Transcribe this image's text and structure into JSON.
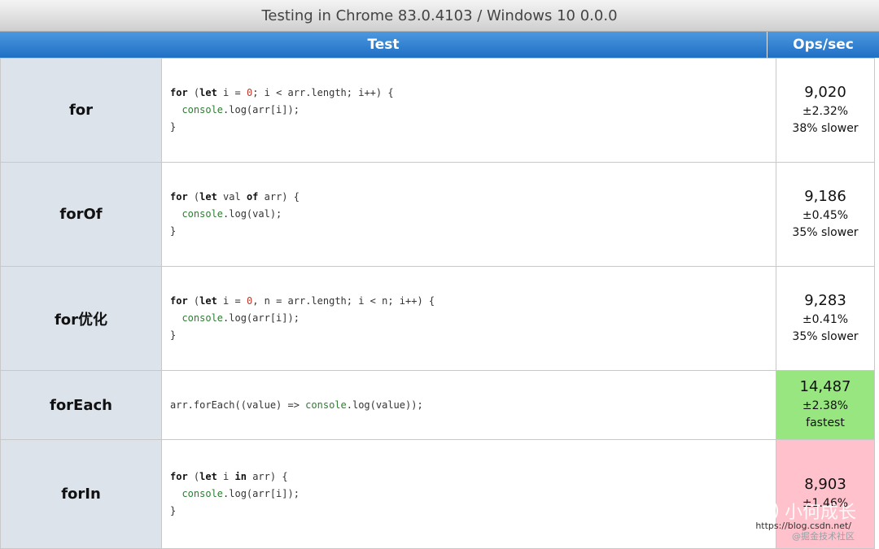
{
  "title_bar": "Testing in Chrome 83.0.4103 / Windows 10 0.0.0",
  "columns": {
    "test": "Test",
    "ops": "Ops/sec"
  },
  "rows": [
    {
      "name": "for",
      "code_lines": [
        [
          [
            "kw",
            "for"
          ],
          [
            "t",
            " ("
          ],
          [
            "kw",
            "let"
          ],
          [
            "t",
            " i = "
          ],
          [
            "num",
            "0"
          ],
          [
            "t",
            "; i < arr.length; i++) {"
          ]
        ],
        [
          [
            "t",
            "  "
          ],
          [
            "fn",
            "console"
          ],
          [
            "t",
            ".log(arr[i]);"
          ]
        ],
        [
          [
            "t",
            "}"
          ]
        ]
      ],
      "ops": "9,020",
      "error": "±2.32%",
      "status": "38% slower",
      "highlight": ""
    },
    {
      "name": "forOf",
      "code_lines": [
        [
          [
            "kw",
            "for"
          ],
          [
            "t",
            " ("
          ],
          [
            "kw",
            "let"
          ],
          [
            "t",
            " val "
          ],
          [
            "kw",
            "of"
          ],
          [
            "t",
            " arr) {"
          ]
        ],
        [
          [
            "t",
            "  "
          ],
          [
            "fn",
            "console"
          ],
          [
            "t",
            ".log(val);"
          ]
        ],
        [
          [
            "t",
            "}"
          ]
        ]
      ],
      "ops": "9,186",
      "error": "±0.45%",
      "status": "35% slower",
      "highlight": ""
    },
    {
      "name": "for优化",
      "code_lines": [
        [
          [
            "kw",
            "for"
          ],
          [
            "t",
            " ("
          ],
          [
            "kw",
            "let"
          ],
          [
            "t",
            " i = "
          ],
          [
            "num",
            "0"
          ],
          [
            "t",
            ", n = arr.length; i < n; i++) {"
          ]
        ],
        [
          [
            "t",
            "  "
          ],
          [
            "fn",
            "console"
          ],
          [
            "t",
            ".log(arr[i]);"
          ]
        ],
        [
          [
            "t",
            "}"
          ]
        ]
      ],
      "ops": "9,283",
      "error": "±0.41%",
      "status": "35% slower",
      "highlight": ""
    },
    {
      "name": "forEach",
      "code_lines": [
        [
          [
            "t",
            "arr.forEach((value) => "
          ],
          [
            "fn",
            "console"
          ],
          [
            "t",
            ".log(value));"
          ]
        ]
      ],
      "ops": "14,487",
      "error": "±2.38%",
      "status": "fastest",
      "highlight": "fastest"
    },
    {
      "name": "forIn",
      "code_lines": [
        [
          [
            "kw",
            "for"
          ],
          [
            "t",
            " ("
          ],
          [
            "kw",
            "let"
          ],
          [
            "t",
            " i "
          ],
          [
            "kw",
            "in"
          ],
          [
            "t",
            " arr) {"
          ]
        ],
        [
          [
            "t",
            "  "
          ],
          [
            "fn",
            "console"
          ],
          [
            "t",
            ".log(arr[i]);"
          ]
        ],
        [
          [
            "t",
            "}"
          ]
        ]
      ],
      "ops": "8,903",
      "error": "±1.46%",
      "status": "",
      "highlight": "slowest"
    }
  ],
  "watermark": {
    "text": "小何成长",
    "icon": "wechat-icon",
    "sub": "@掘金技术社区",
    "site": "https://blog.csdn.net/"
  },
  "colors": {
    "header": "#2f7fd2",
    "fastest": "#98e67f",
    "slowest": "#ffc1cb",
    "name_cell": "#dce3ea"
  }
}
